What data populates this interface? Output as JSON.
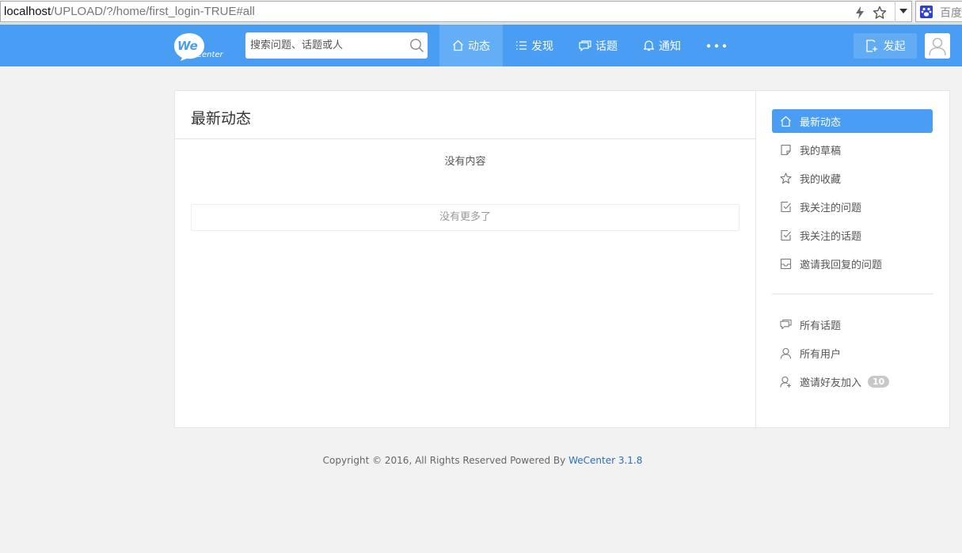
{
  "browser": {
    "url_host": "localhost",
    "url_path": "/UPLOAD/?/home/first_login-TRUE#all",
    "search_engine": "百度"
  },
  "header": {
    "logo_text": "We",
    "logo_subtext": "Center",
    "search_placeholder": "搜索问题、话题或人",
    "nav": [
      {
        "label": "动态",
        "icon": "home-icon",
        "active": true
      },
      {
        "label": "发现",
        "icon": "list-icon",
        "active": false
      },
      {
        "label": "话题",
        "icon": "chat-icon",
        "active": false
      },
      {
        "label": "通知",
        "icon": "bell-icon",
        "active": false
      }
    ],
    "more_icon": "more-dots-icon",
    "publish_label": "发起",
    "brand_color": "#499ef3"
  },
  "main": {
    "title": "最新动态",
    "empty_text": "没有内容",
    "load_more": "没有更多了"
  },
  "sidebar": {
    "items": [
      {
        "label": "最新动态",
        "icon": "home-icon",
        "active": true
      },
      {
        "label": "我的草稿",
        "icon": "draft-icon",
        "active": false
      },
      {
        "label": "我的收藏",
        "icon": "star-icon",
        "active": false
      },
      {
        "label": "我关注的问题",
        "icon": "check-doc-icon",
        "active": false
      },
      {
        "label": "我关注的话题",
        "icon": "check-doc-icon",
        "active": false
      },
      {
        "label": "邀请我回复的问题",
        "icon": "mail-icon",
        "active": false
      }
    ],
    "items2": [
      {
        "label": "所有话题",
        "icon": "chat-icon"
      },
      {
        "label": "所有用户",
        "icon": "user-icon"
      },
      {
        "label": "邀请好友加入",
        "icon": "add-user-icon",
        "badge": "10"
      }
    ]
  },
  "footer": {
    "text": "Copyright © 2016, All Rights Reserved Powered By ",
    "link": "WeCenter 3.1.8"
  }
}
